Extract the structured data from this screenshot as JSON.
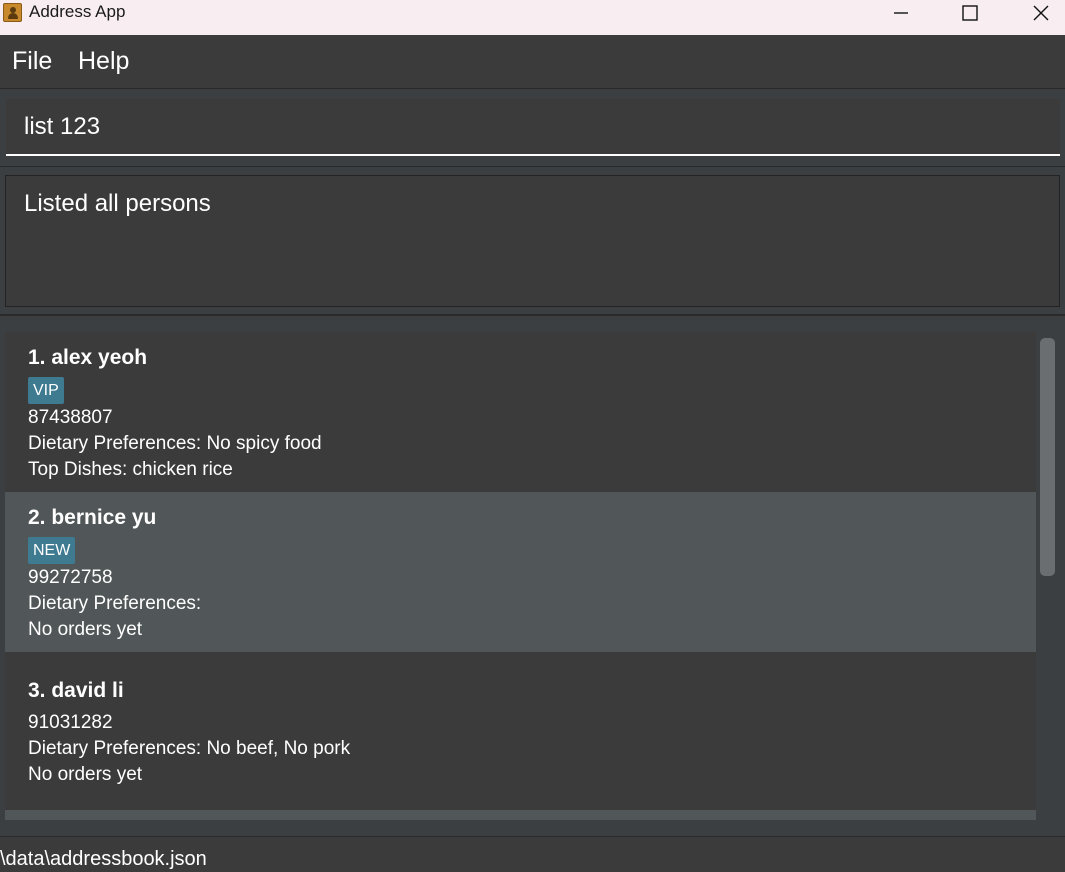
{
  "window": {
    "title": "Address App",
    "icons": [
      "app-icon",
      "minimize-icon",
      "maximize-icon",
      "close-icon"
    ]
  },
  "menu": {
    "items": [
      "File",
      "Help"
    ]
  },
  "command": {
    "value": "list 123"
  },
  "result": {
    "message": "Listed all persons"
  },
  "persons": [
    {
      "name": "1. alex yeoh",
      "tag": "VIP",
      "phone": "87438807",
      "dietary": "Dietary Preferences: No spicy food",
      "dishes": "Top Dishes: chicken rice"
    },
    {
      "name": "2. bernice yu",
      "tag": "NEW",
      "phone": "99272758",
      "dietary": "Dietary Preferences:",
      "dishes": "No orders yet"
    },
    {
      "name": "3. david li",
      "tag": "",
      "phone": "91031282",
      "dietary": "Dietary Preferences: No beef, No pork",
      "dishes": "No orders yet"
    }
  ],
  "colors": {
    "tag_background": "#3e7b91",
    "selected_card": "#515658",
    "card": "#3b3b3b"
  },
  "status": {
    "path": "\\data\\addressbook.json"
  }
}
